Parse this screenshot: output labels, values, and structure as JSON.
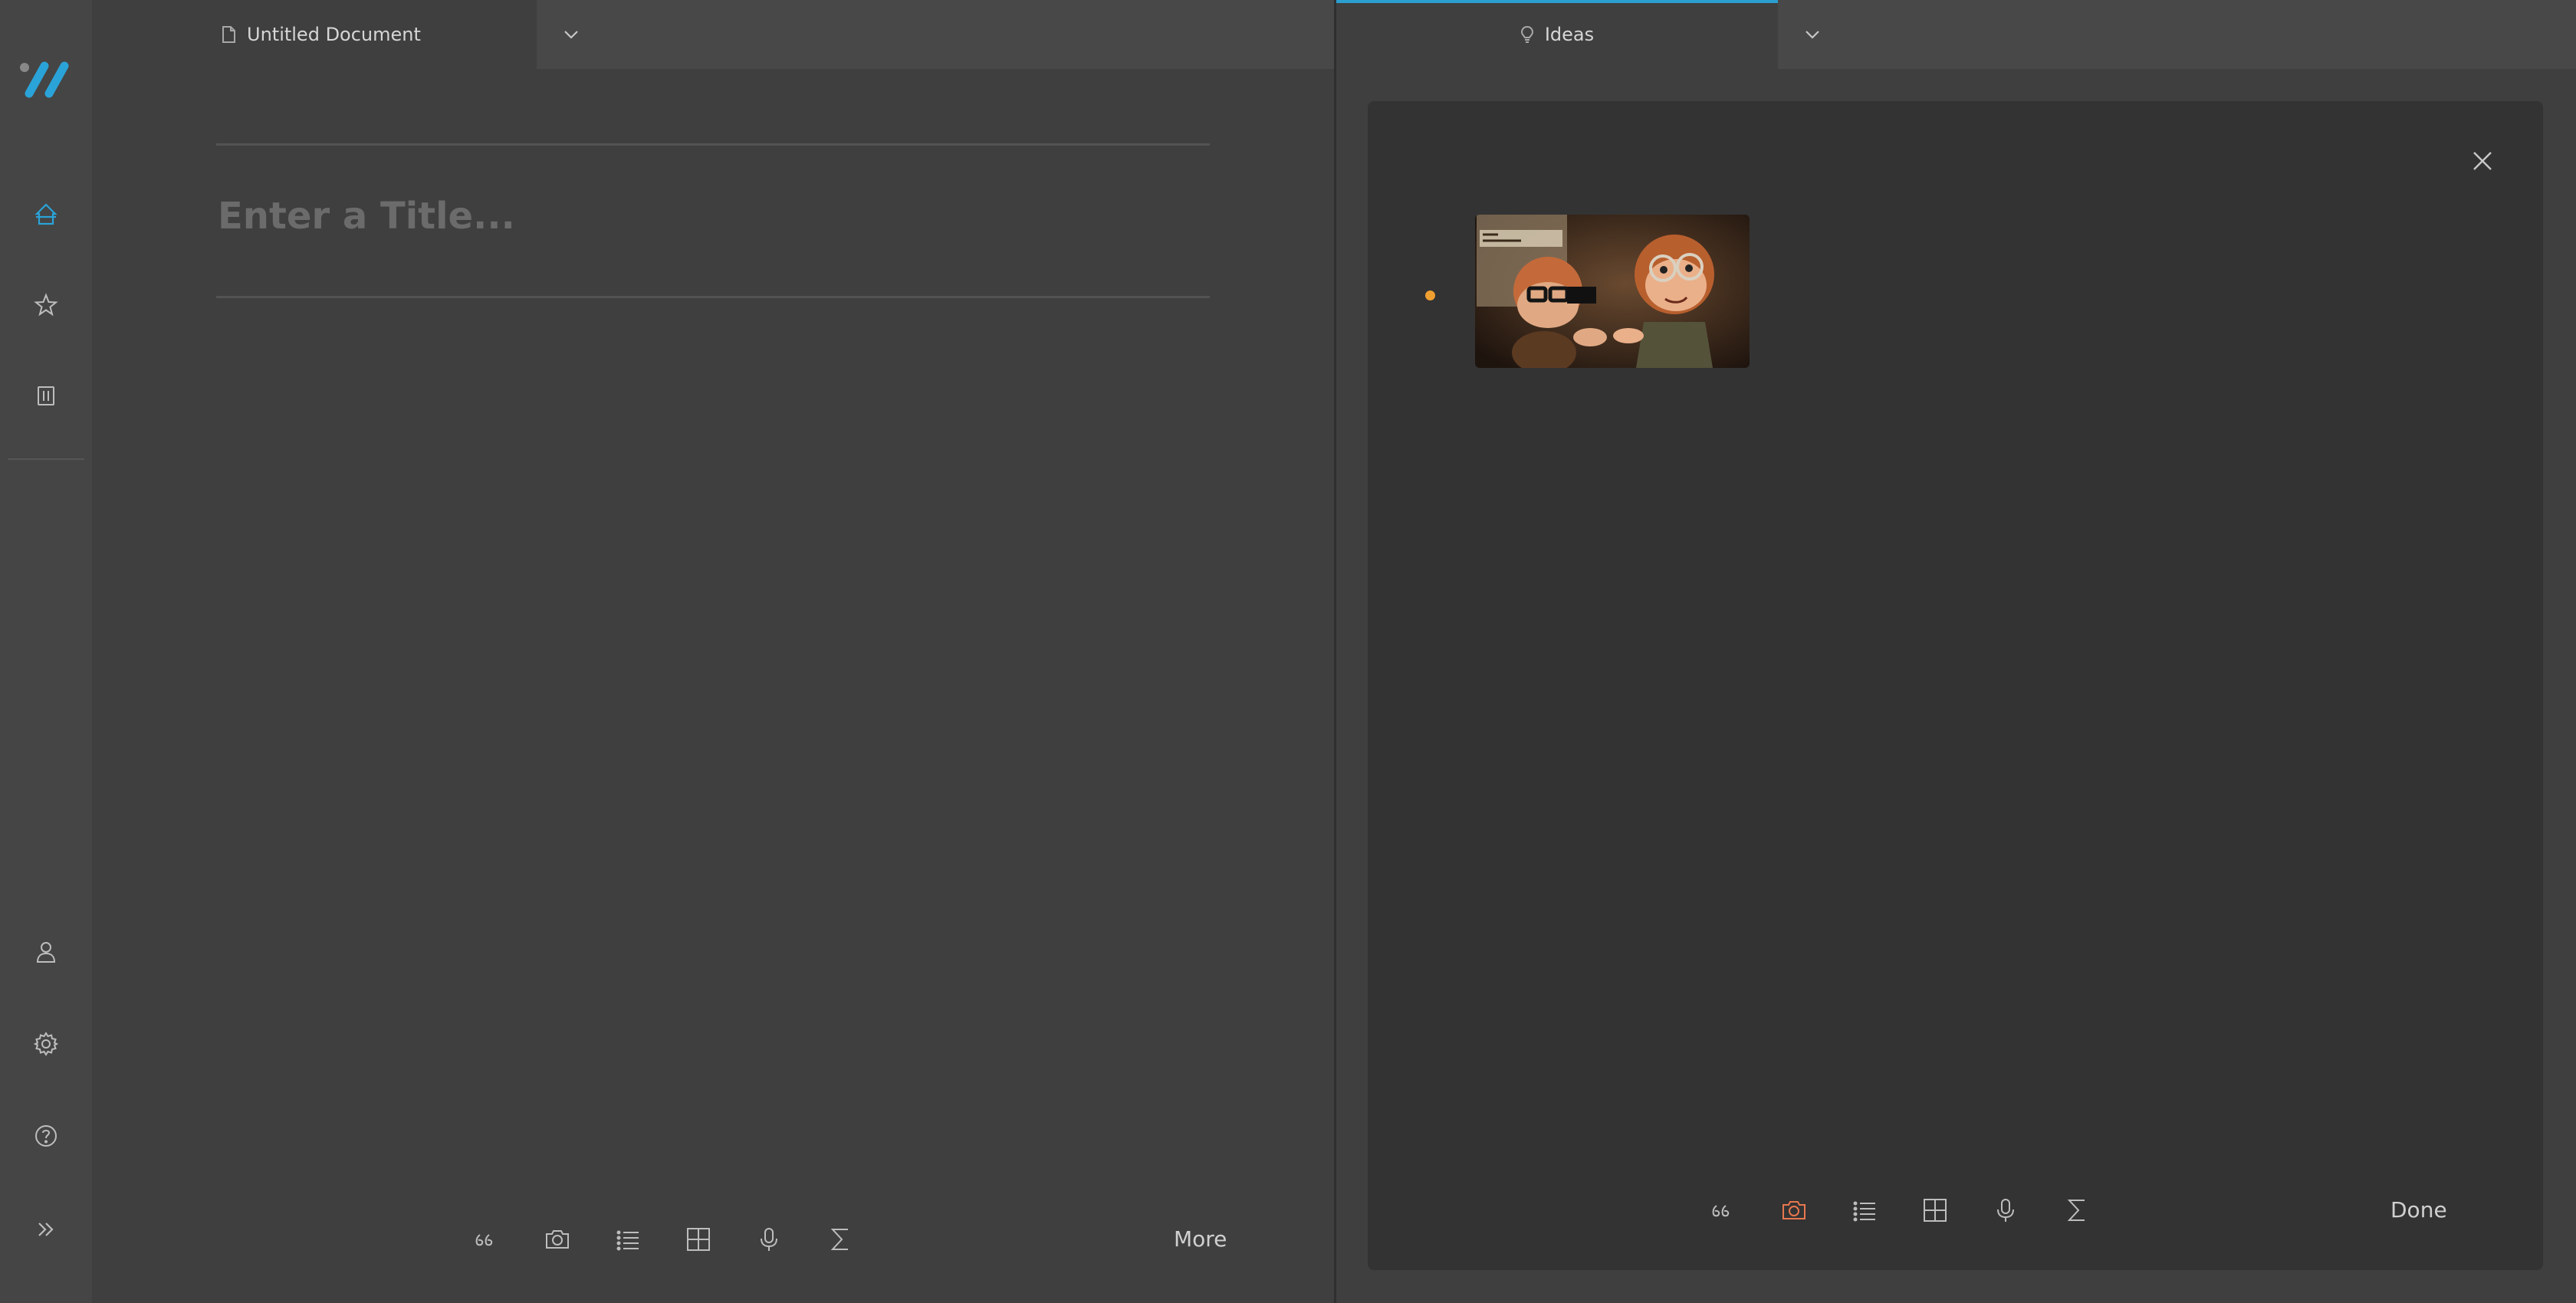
{
  "left": {
    "tab_title": "Untitled Document",
    "title_placeholder": "Enter a Title...",
    "more_label": "More"
  },
  "right": {
    "tab_title": "Ideas",
    "done_label": "Done"
  },
  "icons": {
    "sidebar": [
      "logo",
      "home-icon",
      "star-icon",
      "trash-icon",
      "user-icon",
      "gear-icon",
      "help-icon",
      "expand-icon"
    ],
    "toolbar": [
      "quote-icon",
      "camera-icon",
      "list-icon",
      "table-icon",
      "microphone-icon",
      "sigma-icon"
    ]
  },
  "colors": {
    "accent": "#2a9fd0",
    "active_camera": "#e8774f",
    "bullet": "#f0a030"
  }
}
